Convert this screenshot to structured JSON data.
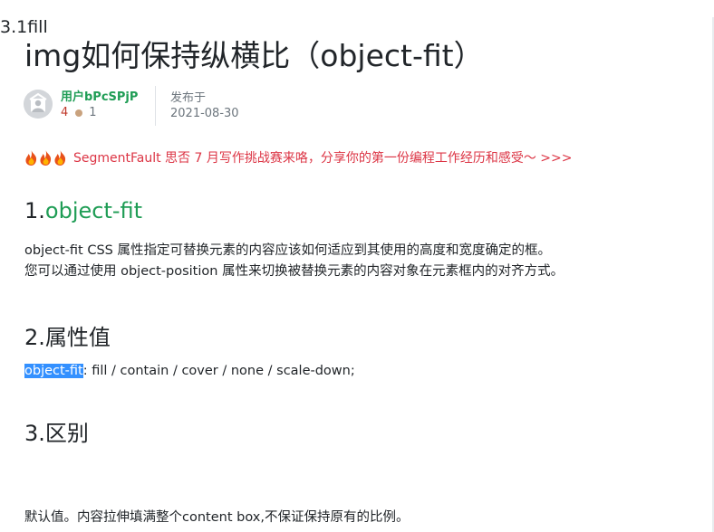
{
  "article": {
    "title": "img如何保持纵横比（object-fit）"
  },
  "author": {
    "name": "用户bPcSPjP",
    "reputation": "4",
    "badge_count": "1",
    "avatar_icon": "user-avatar-icon"
  },
  "published": {
    "label": "发布于",
    "date": "2021-08-30"
  },
  "promo": {
    "icon": "fire-icon",
    "text": "SegmentFault 思否 7 月写作挑战赛来咯，分享你的第一份编程工作经历和感受～ >>>",
    "color": "#dc3545"
  },
  "sections": {
    "s1": {
      "num": "1.",
      "title": "object-fit"
    },
    "s1_p1": "object-fit CSS 属性指定可替换元素的内容应该如何适应到其使用的高度和宽度确定的框。",
    "s1_p2": "您可以通过使用 object-position 属性来切换被替换元素的内容对象在元素框内的对齐方式。",
    "s2": {
      "title": "2.属性值"
    },
    "s2_code_selected": "object-fit",
    "s2_code_rest": ": fill / contain / cover / none / scale-down;",
    "s3": {
      "title": "3.区别"
    },
    "s31": {
      "title": "3.1fill"
    },
    "s31_p": "默认值。内容拉伸填满整个content box,不保证保持原有的比例。"
  },
  "colors": {
    "link_green": "#1f9d55",
    "selection": "#3390ff",
    "text": "#212529",
    "muted": "#6c757d"
  }
}
